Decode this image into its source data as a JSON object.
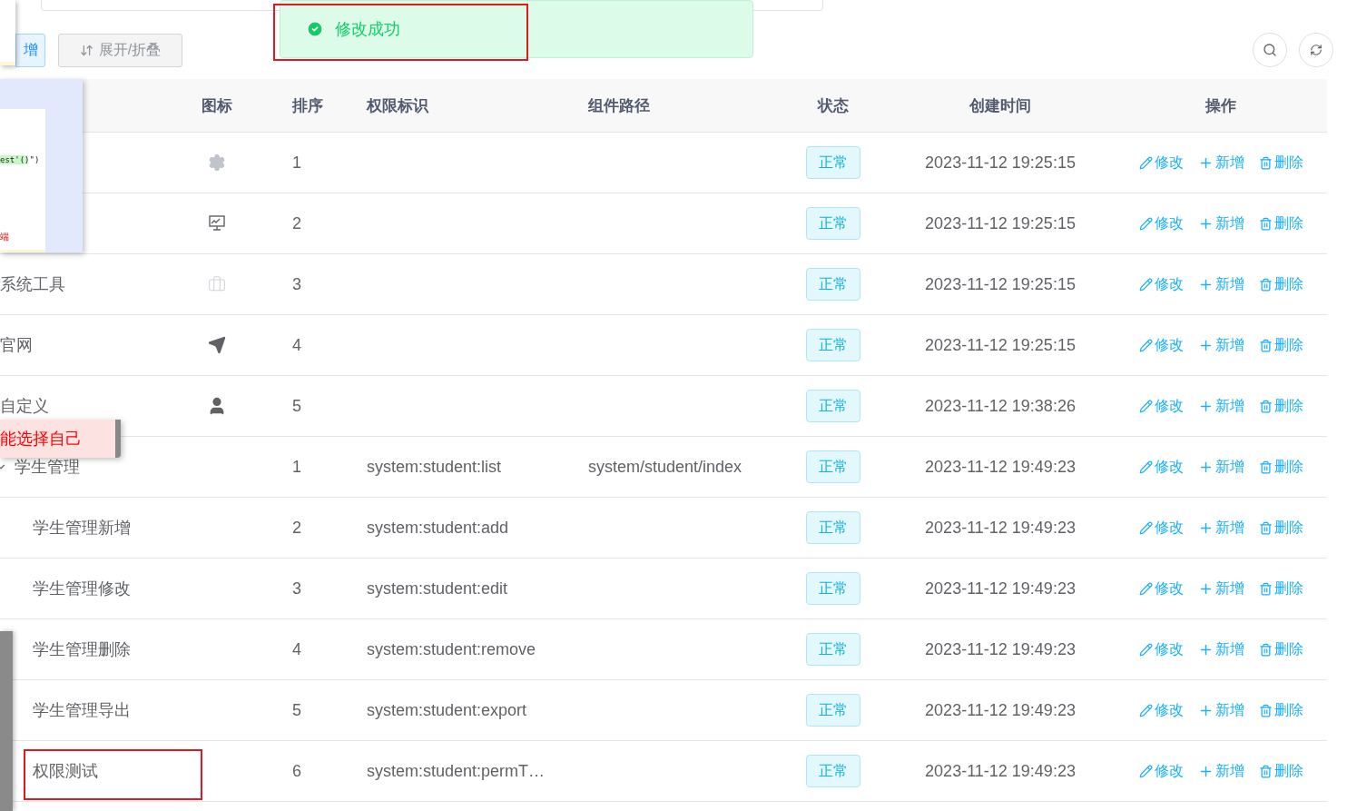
{
  "search_field": {
    "kind": "input"
  },
  "toast": {
    "message": "修改成功",
    "kind": "success"
  },
  "toolbar": {
    "buttons": [
      {
        "label": "增",
        "kind": "primary"
      },
      {
        "label": "展开/折叠",
        "kind": "default"
      }
    ],
    "tools": [
      {
        "kind": "search"
      },
      {
        "kind": "refresh"
      }
    ]
  },
  "snippet_panel": {
    "code": "est'()\")",
    "note": "端"
  },
  "tooltip": {
    "message": "能选择自己"
  },
  "table": {
    "columns": [
      "图标",
      "排序",
      "权限标识",
      "组件路径",
      "状态",
      "创建时间",
      "操作"
    ],
    "rows": [
      {
        "sort": "1",
        "status": "正常",
        "created": "2023-11-12 19:25:15",
        "actions": [
          {
            "kind": "edit",
            "label": "修改"
          },
          {
            "kind": "add",
            "label": "新增"
          },
          {
            "kind": "delete",
            "label": "删除"
          }
        ]
      },
      {
        "sort": "2",
        "status": "正常",
        "created": "2023-11-12 19:25:15",
        "actions": [
          {
            "kind": "edit",
            "label": "修改"
          },
          {
            "kind": "add",
            "label": "新增"
          },
          {
            "kind": "delete",
            "label": "删除"
          }
        ]
      },
      {
        "name": "系统工具",
        "sort": "3",
        "status": "正常",
        "created": "2023-11-12 19:25:15",
        "actions": [
          {
            "kind": "edit",
            "label": "修改"
          },
          {
            "kind": "add",
            "label": "新增"
          },
          {
            "kind": "delete",
            "label": "删除"
          }
        ]
      },
      {
        "name": "官网",
        "sort": "4",
        "status": "正常",
        "created": "2023-11-12 19:25:15",
        "actions": [
          {
            "kind": "edit",
            "label": "修改"
          },
          {
            "kind": "add",
            "label": "新增"
          },
          {
            "kind": "delete",
            "label": "删除"
          }
        ]
      },
      {
        "name": "自定义",
        "sort": "5",
        "status": "正常",
        "created": "2023-11-12 19:38:26",
        "actions": [
          {
            "kind": "edit",
            "label": "修改"
          },
          {
            "kind": "add",
            "label": "新增"
          },
          {
            "kind": "delete",
            "label": "删除"
          }
        ]
      },
      {
        "name": "学生管理",
        "expanded": true,
        "sort": "1",
        "perms": "system:student:list",
        "component": "system/student/index",
        "status": "正常",
        "created": "2023-11-12 19:49:23",
        "actions": [
          {
            "kind": "edit",
            "label": "修改"
          },
          {
            "kind": "add",
            "label": "新增"
          },
          {
            "kind": "delete",
            "label": "删除"
          }
        ],
        "children": [
          {
            "name": "学生管理新增",
            "sort": "2",
            "perms": "system:student:add",
            "status": "正常",
            "created": "2023-11-12 19:49:23",
            "actions": [
              {
                "kind": "edit",
                "label": "修改"
              },
              {
                "kind": "add",
                "label": "新增"
              },
              {
                "kind": "delete",
                "label": "删除"
              }
            ]
          },
          {
            "name": "学生管理修改",
            "sort": "3",
            "perms": "system:student:edit",
            "status": "正常",
            "created": "2023-11-12 19:49:23",
            "actions": [
              {
                "kind": "edit",
                "label": "修改"
              },
              {
                "kind": "add",
                "label": "新增"
              },
              {
                "kind": "delete",
                "label": "删除"
              }
            ]
          },
          {
            "name": "学生管理删除",
            "sort": "4",
            "perms": "system:student:remove",
            "status": "正常",
            "created": "2023-11-12 19:49:23",
            "actions": [
              {
                "kind": "edit",
                "label": "修改"
              },
              {
                "kind": "add",
                "label": "新增"
              },
              {
                "kind": "delete",
                "label": "删除"
              }
            ]
          },
          {
            "name": "学生管理导出",
            "sort": "5",
            "perms": "system:student:export",
            "status": "正常",
            "created": "2023-11-12 19:49:23",
            "actions": [
              {
                "kind": "edit",
                "label": "修改"
              },
              {
                "kind": "add",
                "label": "新增"
              },
              {
                "kind": "delete",
                "label": "删除"
              }
            ]
          },
          {
            "name": "权限测试",
            "highlighted": true,
            "sort": "6",
            "perms": "system:student:permT…",
            "status": "正常",
            "created": "2023-11-12 19:49:23",
            "actions": [
              {
                "kind": "edit",
                "label": "修改"
              },
              {
                "kind": "add",
                "label": "新增"
              },
              {
                "kind": "delete",
                "label": "删除"
              }
            ]
          }
        ]
      }
    ]
  }
}
